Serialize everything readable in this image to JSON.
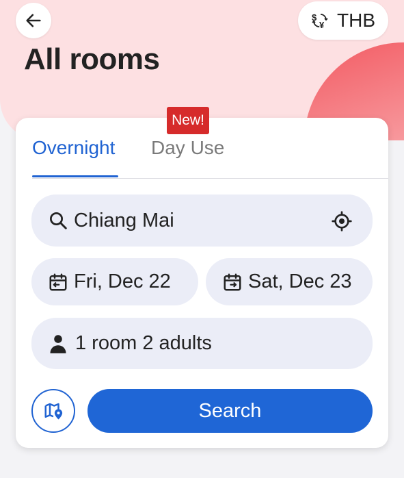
{
  "header": {
    "title": "All rooms",
    "currency": "THB"
  },
  "tabs": [
    {
      "label": "Overnight",
      "selected": true
    },
    {
      "label": "Day Use",
      "selected": false,
      "badge": "New!"
    }
  ],
  "search": {
    "destination": "Chiang Mai",
    "checkin": "Fri, Dec 22",
    "checkout": "Sat, Dec 23",
    "guests": "1 room 2 adults",
    "button_label": "Search"
  },
  "colors": {
    "accent": "#2063d2",
    "badge": "#d62b2b",
    "hero_bg": "#fde0e2",
    "pill_bg": "#ebedf7"
  },
  "icons": [
    "back-arrow-icon",
    "currency-exchange-icon",
    "search-icon",
    "locate-icon",
    "calendar-checkin-icon",
    "calendar-checkout-icon",
    "person-icon",
    "map-pin-icon"
  ]
}
